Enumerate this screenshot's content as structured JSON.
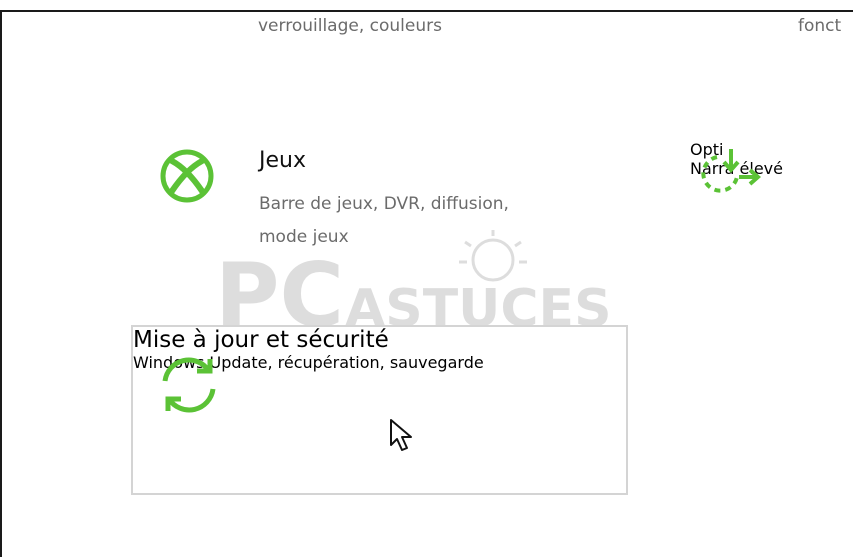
{
  "top_row": {
    "left_desc": "verrouillage, couleurs",
    "right_desc": "fonct"
  },
  "tiles": {
    "jeux": {
      "title": "Jeux",
      "desc": "Barre de jeux, DVR, diffusion,\nmode jeux",
      "icon": "xbox-icon"
    },
    "options": {
      "title": "Opti",
      "desc": "Narra\nélevé",
      "icon": "ease-of-access-icon"
    },
    "update": {
      "title": "Mise à jour et sécurité",
      "desc": "Windows Update, récupération,\nsauvegarde",
      "icon": "sync-icon"
    }
  },
  "watermark": {
    "text_a": "PC",
    "text_b": "ASTUCES"
  },
  "colors": {
    "accent": "#5bc236",
    "border_hover": "#d4d4d4"
  }
}
